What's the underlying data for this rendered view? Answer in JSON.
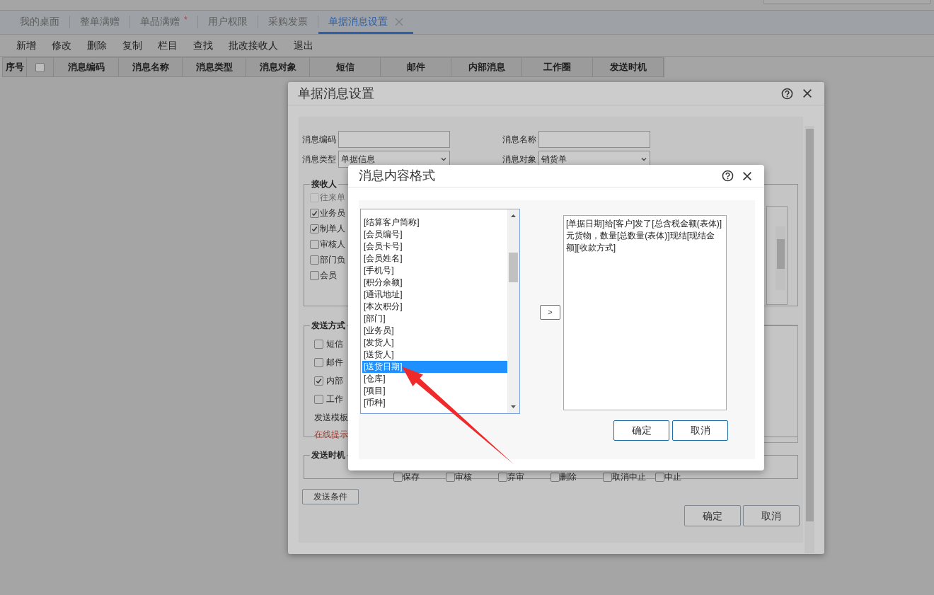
{
  "tabs": [
    {
      "label": "我的桌面",
      "selected": false
    },
    {
      "label": "整单满赠",
      "selected": false
    },
    {
      "label": "单品满赠",
      "badge": "*",
      "selected": false
    },
    {
      "label": "用户权限",
      "selected": false
    },
    {
      "label": "采购发票",
      "selected": false
    },
    {
      "label": "单据消息设置",
      "selected": true
    }
  ],
  "toolbar": [
    "新增",
    "修改",
    "删除",
    "复制",
    "栏目",
    "查找",
    "批改接收人",
    "退出"
  ],
  "grid": {
    "header_checkbox": {
      "checked": false
    },
    "columns": [
      "序号",
      "消息编码",
      "消息名称",
      "消息类型",
      "消息对象",
      "短信",
      "邮件",
      "内部消息",
      "工作圈",
      "发送时机"
    ]
  },
  "settings_dialog": {
    "title": "单据消息设置",
    "fields": [
      {
        "kind": "input",
        "label": "消息编码"
      },
      {
        "kind": "input",
        "label": "消息名称"
      },
      {
        "kind": "select",
        "label": "消息类型",
        "value": "单据信息"
      },
      {
        "kind": "select",
        "label": "消息对象",
        "value": "销货单"
      }
    ],
    "receivers": {
      "legend": "接收人",
      "items": [
        {
          "label": "往来单",
          "checked": false,
          "disabled": true
        },
        {
          "label": "业务员",
          "checked": true,
          "disabled": false
        },
        {
          "label": "制单人",
          "checked": true,
          "disabled": false
        },
        {
          "label": "审核人",
          "checked": false,
          "disabled": false
        },
        {
          "label": "部门负",
          "checked": false,
          "disabled": false
        },
        {
          "label": "会员",
          "checked": false,
          "disabled": false
        }
      ]
    },
    "send_methods": {
      "legend": "发送方式",
      "items": [
        {
          "kind": "checkbox",
          "label": "短信",
          "checked": false
        },
        {
          "kind": "checkbox",
          "label": "邮件",
          "checked": false
        },
        {
          "kind": "checkbox",
          "label": "内部",
          "checked": true
        },
        {
          "kind": "checkbox",
          "label": "工作",
          "checked": false
        },
        {
          "kind": "text",
          "label": "发送模板"
        },
        {
          "kind": "hint",
          "label": "在线提示"
        }
      ]
    },
    "send_timing": {
      "legend": "发送时机",
      "items": [
        {
          "label": "保存",
          "checked": false
        },
        {
          "label": "审核",
          "checked": false
        },
        {
          "label": "弃审",
          "checked": false
        },
        {
          "label": "删除",
          "checked": false
        },
        {
          "label": "取消中止",
          "checked": false
        },
        {
          "label": "中止",
          "checked": false
        }
      ]
    },
    "conditions_button": "发送条件",
    "buttons": [
      "确定",
      "取消"
    ]
  },
  "format_dialog": {
    "title": "消息内容格式",
    "fields_list": [
      {
        "label": "[结算客户简称]",
        "selected": false
      },
      {
        "label": "[会员编号]",
        "selected": false
      },
      {
        "label": "[会员卡号]",
        "selected": false
      },
      {
        "label": "[会员姓名]",
        "selected": false
      },
      {
        "label": "[手机号]",
        "selected": false
      },
      {
        "label": "[积分余额]",
        "selected": false
      },
      {
        "label": "[通讯地址]",
        "selected": false
      },
      {
        "label": "[本次积分]",
        "selected": false
      },
      {
        "label": "[部门]",
        "selected": false
      },
      {
        "label": "[业务员]",
        "selected": false
      },
      {
        "label": "[发货人]",
        "selected": false
      },
      {
        "label": "[送货人]",
        "selected": false
      },
      {
        "label": "[送货日期]",
        "selected": true
      },
      {
        "label": "[仓库]",
        "selected": false
      },
      {
        "label": "[项目]",
        "selected": false
      },
      {
        "label": "[币种]",
        "selected": false
      }
    ],
    "move_button": ">",
    "content": "[单据日期]给[客户]发了[总含税金额(表体)]元货物，数量[总数量(表体)]现结[现结金额][收款方式]",
    "buttons": [
      "确定",
      "取消"
    ]
  }
}
